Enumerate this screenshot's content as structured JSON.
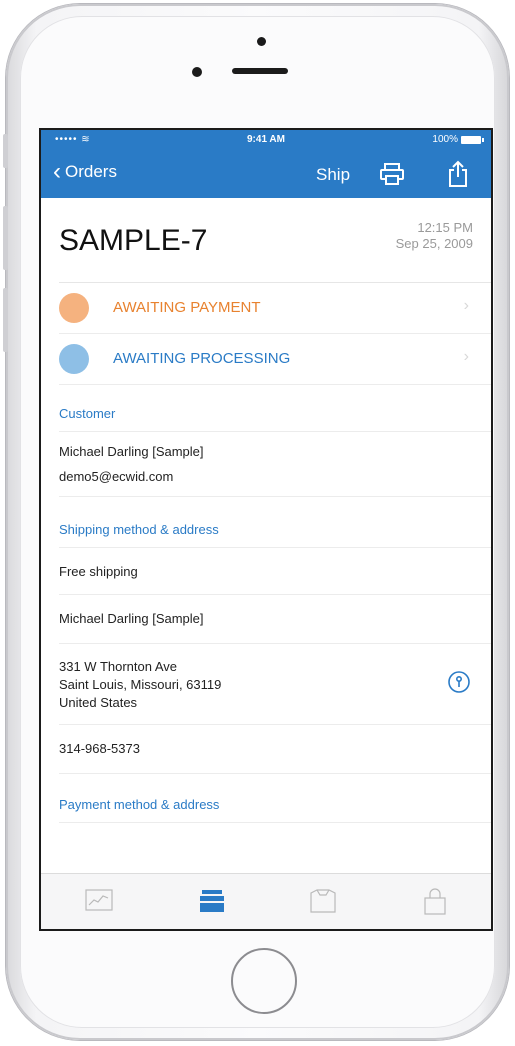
{
  "status_bar": {
    "signal": "••••• ≋",
    "time": "9:41 AM",
    "battery": "100%"
  },
  "nav": {
    "back_label": "Orders",
    "ship_label": "Ship",
    "print_icon": "printer-icon",
    "share_icon": "share-icon"
  },
  "order": {
    "id": "SAMPLE-7",
    "time": "12:15 PM",
    "date": "Sep 25, 2009"
  },
  "statuses": [
    {
      "label": "AWAITING PAYMENT",
      "color": "#e8822f",
      "dot": "#f5b27f"
    },
    {
      "label": "AWAITING PROCESSING",
      "color": "#2a7bc6",
      "dot": "#8ebfe6"
    }
  ],
  "customer": {
    "title": "Customer",
    "name": "Michael Darling [Sample]",
    "email": "demo5@ecwid.com"
  },
  "shipping": {
    "title": "Shipping method & address",
    "method": "Free shipping",
    "name": "Michael Darling [Sample]",
    "address_line1": "331 W Thornton Ave",
    "address_line2": "Saint Louis, Missouri, 63119",
    "address_line3": "United States",
    "phone": "314-968-5373"
  },
  "payment": {
    "title": "Payment method & address"
  },
  "tabbar": {
    "tabs": [
      "stats-icon",
      "orders-icon",
      "products-icon",
      "store-icon"
    ],
    "active": "orders-icon"
  }
}
